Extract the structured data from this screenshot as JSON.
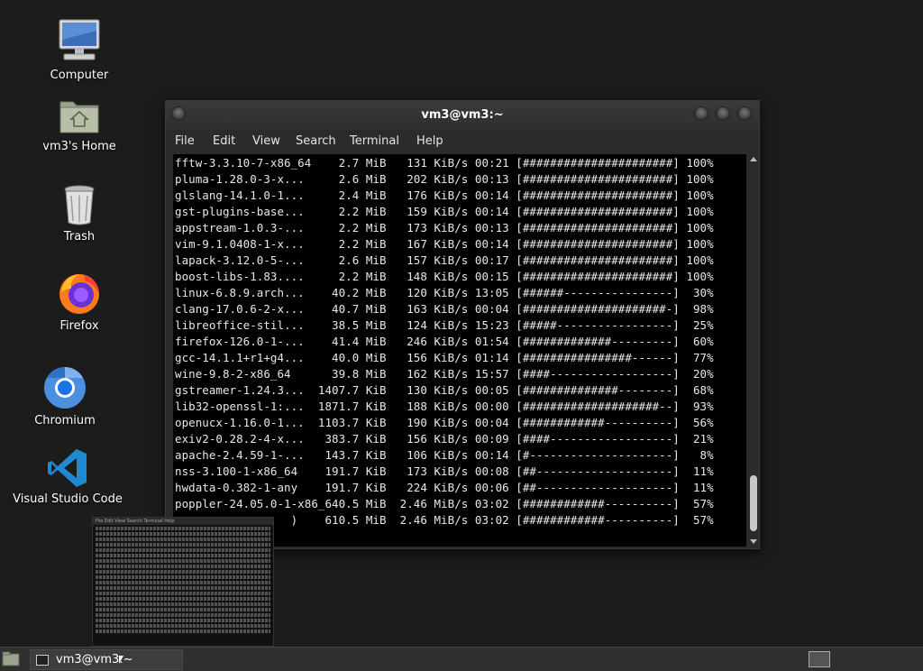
{
  "desktop": {
    "icons": [
      {
        "label": "Computer"
      },
      {
        "label": "vm3's Home"
      },
      {
        "label": "Trash"
      },
      {
        "label": "Firefox"
      },
      {
        "label": "Chromium"
      },
      {
        "label": "Visual Studio Code"
      }
    ]
  },
  "terminal": {
    "title": "vm3@vm3:~",
    "menu": [
      "File",
      "Edit",
      "View",
      "Search",
      "Terminal",
      "Help"
    ],
    "lines": [
      "fftw-3.3.10-7-x86_64    2.7 MiB   131 KiB/s 00:21 [######################] 100%",
      "pluma-1.28.0-3-x...     2.6 MiB   202 KiB/s 00:13 [######################] 100%",
      "glslang-14.1.0-1...     2.4 MiB   176 KiB/s 00:14 [######################] 100%",
      "gst-plugins-base...     2.2 MiB   159 KiB/s 00:14 [######################] 100%",
      "appstream-1.0.3-...     2.2 MiB   173 KiB/s 00:13 [######################] 100%",
      "vim-9.1.0408-1-x...     2.2 MiB   167 KiB/s 00:14 [######################] 100%",
      "lapack-3.12.0-5-...     2.6 MiB   157 KiB/s 00:17 [######################] 100%",
      "boost-libs-1.83....     2.2 MiB   148 KiB/s 00:15 [######################] 100%",
      "linux-6.8.9.arch...    40.2 MiB   120 KiB/s 13:05 [######----------------]  30%",
      "clang-17.0.6-2-x...    40.7 MiB   163 KiB/s 00:04 [#####################-]  98%",
      "libreoffice-stil...    38.5 MiB   124 KiB/s 15:23 [#####-----------------]  25%",
      "firefox-126.0-1-...    41.4 MiB   246 KiB/s 01:54 [#############---------]  60%",
      "gcc-14.1.1+r1+g4...    40.0 MiB   156 KiB/s 01:14 [################------]  77%",
      "wine-9.8-2-x86_64      39.8 MiB   162 KiB/s 15:57 [####------------------]  20%",
      "gstreamer-1.24.3...  1407.7 KiB   130 KiB/s 00:05 [##############--------]  68%",
      "lib32-openssl-1:...  1871.7 KiB   188 KiB/s 00:00 [####################--]  93%",
      "openucx-1.16.0-1...  1103.7 KiB   190 KiB/s 00:04 [############----------]  56%",
      "exiv2-0.28.2-4-x...   383.7 KiB   156 KiB/s 00:09 [####------------------]  21%",
      "apache-2.4.59-1-...   143.7 KiB   106 KiB/s 00:14 [#---------------------]   8%",
      "nss-3.100-1-x86_64    191.7 KiB   173 KiB/s 00:08 [##--------------------]  11%",
      "hwdata-0.382-1-any    191.7 KiB   224 KiB/s 00:06 [##--------------------]  11%",
      "poppler-24.05.0-1-x86_640.5 MiB  2.46 MiB/s 03:02 [############----------]  57%",
      "                 )    610.5 MiB  2.46 MiB/s 03:02 [############----------]  57%"
    ]
  },
  "thumbnail": {
    "menu": "File  Edit  View  Search  Terminal  Help"
  },
  "taskbar": {
    "task_label": "vm3@vm3:~"
  }
}
